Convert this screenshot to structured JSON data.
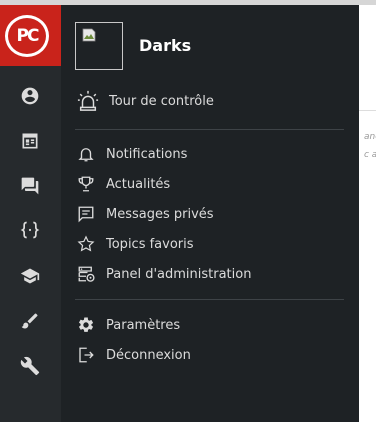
{
  "logo": {
    "text": "PC",
    "color": "#c9231b"
  },
  "user": {
    "name": "Darks",
    "avatar_icon": "broken-image-icon"
  },
  "rail": [
    {
      "id": "profile",
      "icon": "user-circle-icon"
    },
    {
      "id": "calendar",
      "icon": "calendar-icon"
    },
    {
      "id": "forum",
      "icon": "chat-icon"
    },
    {
      "id": "code",
      "icon": "braces-icon"
    },
    {
      "id": "learn",
      "icon": "graduation-cap-icon"
    },
    {
      "id": "design",
      "icon": "brush-icon"
    },
    {
      "id": "tools",
      "icon": "wrench-icon"
    }
  ],
  "menu": {
    "dashboard": {
      "label": "Tour de contrôle",
      "icon": "siren-icon"
    },
    "notifications": {
      "label": "Notifications",
      "icon": "bell-icon"
    },
    "news": {
      "label": "Actualités",
      "icon": "trophy-icon"
    },
    "messages": {
      "label": "Messages privés",
      "icon": "message-icon"
    },
    "favorites": {
      "label": "Topics favoris",
      "icon": "star-icon"
    },
    "admin": {
      "label": "Panel d'administration",
      "icon": "admin-server-icon"
    },
    "settings": {
      "label": "Paramètres",
      "icon": "gear-icon"
    },
    "logout": {
      "label": "Déconnexion",
      "icon": "logout-icon"
    }
  },
  "background_page": {
    "fragment1": "ané",
    "fragment2": "c au"
  },
  "colors": {
    "rail": "#262a2d",
    "panel": "#1e2225",
    "text": "#dcdcdc",
    "accent": "#c9231b"
  }
}
